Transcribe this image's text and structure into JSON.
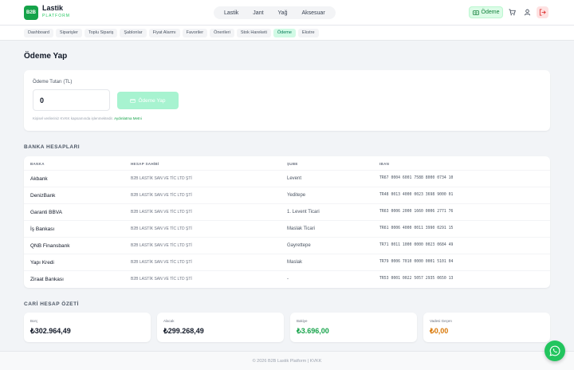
{
  "brand": {
    "logo": "B2B",
    "name": "Lastik",
    "sub": "PLATFORM"
  },
  "topnav": [
    "Lastik",
    "Jant",
    "Yağ",
    "Aksesuar"
  ],
  "header": {
    "odeme_label": "Ödeme",
    "odeme_icon": "money-icon",
    "cart_icon": "cart-icon",
    "user_icon": "user-icon",
    "logout_icon": "logout-icon"
  },
  "subnav": {
    "items": [
      "Dashboard",
      "Siparişler",
      "Toplu Sipariş",
      "Şablonlar",
      "Fiyat Alarmı",
      "Favoriler",
      "Önerileri",
      "Stok Hareketi",
      "Ödeme",
      "Ekstre"
    ],
    "active_index": 8
  },
  "page": {
    "title": "Ödeme Yap"
  },
  "payment": {
    "amount_label": "Ödeme Tutarı (TL)",
    "amount_value": "0",
    "button_label": "Ödeme Yap",
    "note_text": "Kişisel verileriniz KVKK kapsamında işlenmektedir.",
    "note_link": "Aydınlatma Metni"
  },
  "banks": {
    "section_title": "BANKA HESAPLARI",
    "columns": [
      "BANKA",
      "HESAP SAHİBİ",
      "ŞUBE",
      "IBAN"
    ],
    "rows": [
      {
        "bank": "Akbank",
        "owner": "B2B LASTİK SAN VE TİC LTD ŞTİ",
        "branch": "Levent",
        "iban": "TR67 0004 6001 7588 8000 0734 10"
      },
      {
        "bank": "DenizBank",
        "owner": "B2B LASTİK SAN VE TİC LTD ŞTİ",
        "branch": "Yeditepe",
        "iban": "TR48 0013 4000 0023 3698 9000 01"
      },
      {
        "bank": "Garanti BBVA",
        "owner": "B2B LASTİK SAN VE TİC LTD ŞTİ",
        "branch": "1. Levent Ticari",
        "iban": "TR63 0006 2000 1660 0006 2771 76"
      },
      {
        "bank": "İş Bankası",
        "owner": "B2B LASTİK SAN VE TİC LTD ŞTİ",
        "branch": "Maslak Ticari",
        "iban": "TR61 0006 4000 0011 3990 0291 15"
      },
      {
        "bank": "QNB Finansbank",
        "owner": "B2B LASTİK SAN VE TİC LTD ŞTİ",
        "branch": "Gayrettepe",
        "iban": "TR71 0011 1000 0000 0023 0684 49"
      },
      {
        "bank": "Yapı Kredi",
        "owner": "B2B LASTİK SAN VE TİC LTD ŞTİ",
        "branch": "Maslak",
        "iban": "TR79 0006 7010 0000 0001 5101 04"
      },
      {
        "bank": "Ziraat Bankası",
        "owner": "B2B LASTİK SAN VE TİC LTD ŞTİ",
        "branch": "-",
        "iban": "TR53 0001 0022 5057 2935 0650 13"
      }
    ]
  },
  "summary": {
    "section_title": "CARİ HESAP ÖZETİ",
    "cards": [
      {
        "label": "Borç",
        "value": "₺302.964,49",
        "color": "#111827"
      },
      {
        "label": "Alacak",
        "value": "₺299.268,49",
        "color": "#111827"
      },
      {
        "label": "Bakiye",
        "value": "₺3.696,00",
        "color": "#16a34a"
      },
      {
        "label": "Vadesi Geçen",
        "value": "₺0,00",
        "color": "#d97706"
      }
    ]
  },
  "footer": {
    "text": "© 2026 B2B Lastik Platform  |  KVKK"
  },
  "whatsapp": {
    "icon": "whatsapp-icon"
  }
}
